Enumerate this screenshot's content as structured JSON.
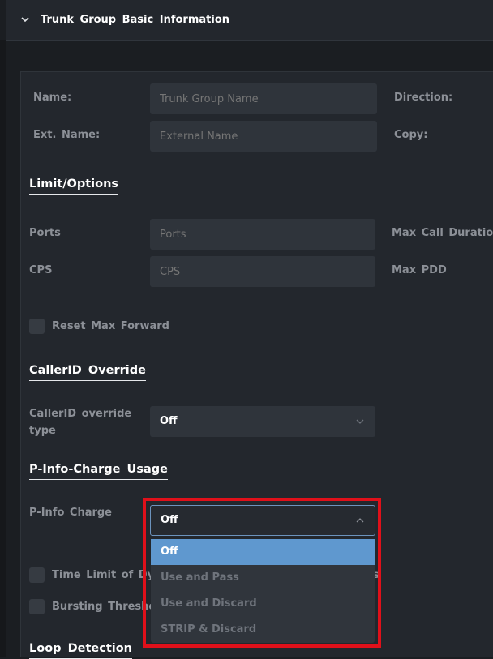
{
  "header": {
    "title": "Trunk Group Basic Information"
  },
  "basic": {
    "name_label": "Name:",
    "name_placeholder": "Trunk Group Name",
    "direction_label": "Direction:",
    "ext_name_label": "Ext. Name:",
    "ext_name_placeholder": "External Name",
    "copy_label": "Copy:"
  },
  "limits": {
    "heading": "Limit/Options",
    "ports_label": "Ports",
    "ports_placeholder": "Ports",
    "max_call_label": "Max Call Duration",
    "cps_label": "CPS",
    "cps_placeholder": "CPS",
    "max_pdd_label": "Max PDD",
    "reset_label": "Reset Max Forward"
  },
  "callerid": {
    "heading": "CallerID Override",
    "type_label_line1": "CallerID override",
    "type_label_line2": "type",
    "type_value": "Off"
  },
  "pinfo": {
    "heading": "P-Info-Charge Usage",
    "label": "P-Info Charge",
    "value": "Off",
    "options": [
      "Off",
      "Use and Pass",
      "Use and Discard",
      "STRIP & Discard"
    ],
    "selected_index": 0
  },
  "other": {
    "time_limit_label": "Time Limit of Dy",
    "time_limit_tail": "s",
    "bursting_label": "Bursting Thresho",
    "loop_heading": "Loop Detection"
  },
  "colors": {
    "accent": "#5f98cf",
    "highlight": "#e0101a"
  }
}
